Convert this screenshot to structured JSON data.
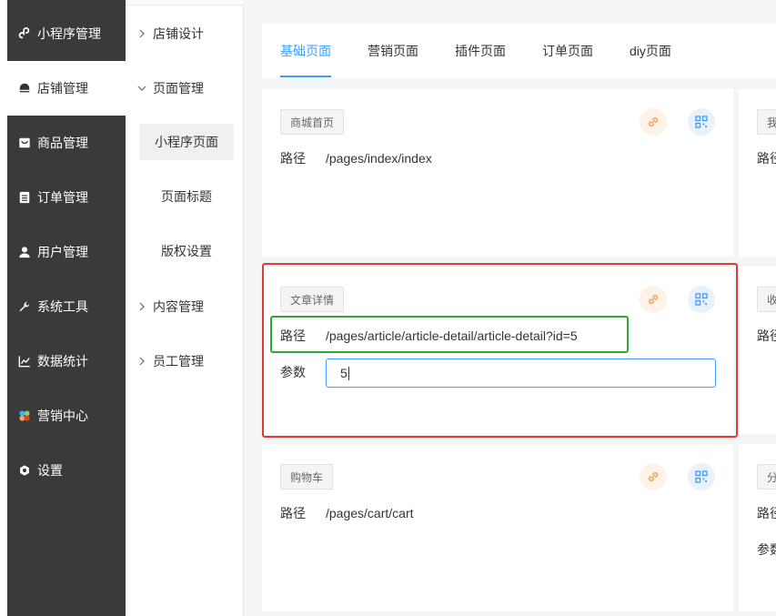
{
  "sidebar": {
    "items": [
      {
        "label": "小程序管理",
        "icon": "miniprogram-icon"
      },
      {
        "label": "店铺管理",
        "icon": "shop-icon"
      },
      {
        "label": "商品管理",
        "icon": "goods-icon"
      },
      {
        "label": "订单管理",
        "icon": "order-icon"
      },
      {
        "label": "用户管理",
        "icon": "user-icon"
      },
      {
        "label": "系统工具",
        "icon": "wrench-icon"
      },
      {
        "label": "数据统计",
        "icon": "chart-icon"
      },
      {
        "label": "营销中心",
        "icon": "marketing-icon"
      },
      {
        "label": "设置",
        "icon": "settings-icon"
      }
    ],
    "active": "店铺管理"
  },
  "submenu": {
    "items": [
      {
        "label": "店铺设计",
        "expanded": false
      },
      {
        "label": "页面管理",
        "expanded": true
      },
      {
        "label": "小程序页面"
      },
      {
        "label": "页面标题"
      },
      {
        "label": "版权设置"
      },
      {
        "label": "内容管理",
        "expanded": false
      },
      {
        "label": "员工管理",
        "expanded": false
      }
    ],
    "active": "小程序页面"
  },
  "tabs": [
    "基础页面",
    "营销页面",
    "插件页面",
    "订单页面",
    "diy页面"
  ],
  "active_tab": "基础页面",
  "cards": [
    {
      "tag": "商城首页",
      "path_label": "路径",
      "path": "/pages/index/index"
    },
    {
      "tag": "文章详情",
      "path_label": "路径",
      "path": "/pages/article/article-detail/article-detail?id=5",
      "param_label": "参数",
      "param_value": "5"
    },
    {
      "tag": "购物车",
      "path_label": "路径",
      "path": "/pages/cart/cart"
    }
  ],
  "right_cards": [
    {
      "tag_partial": "我",
      "path_label_partial": "路径"
    },
    {
      "tag_partial": "收",
      "path_label_partial": "路径"
    },
    {
      "tag_partial": "分",
      "path_label_partial": "路径",
      "param_label_partial": "参数"
    }
  ],
  "colors": {
    "accent": "#409eff",
    "sidebar_bg": "#3a3a3a",
    "highlight_red": "#e53935",
    "highlight_green": "#2ea82e",
    "link_icon": "#f5a25d",
    "qr_icon": "#409eff"
  }
}
